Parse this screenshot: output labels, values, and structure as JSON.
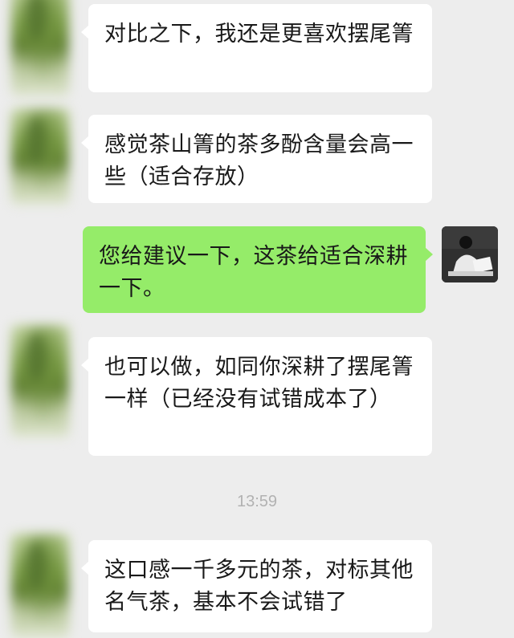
{
  "messages": [
    {
      "side": "left",
      "text": "对比之下，我还是更喜欢摆尾箐"
    },
    {
      "side": "left",
      "text": "感觉茶山箐的茶多酚含量会高一些（适合存放）"
    },
    {
      "side": "right",
      "text": "您给建议一下，这茶给适合深耕一下。"
    },
    {
      "side": "left",
      "text": "也可以做，如同你深耕了摆尾箐一样（已经没有试错成本了）"
    },
    {
      "side": "left",
      "text": "这口感一千多元的茶，对标其他名气茶，基本不会试错了"
    }
  ],
  "timestamp": "13:59",
  "colors": {
    "background": "#ededed",
    "incoming_bubble": "#ffffff",
    "outgoing_bubble": "#95ec69",
    "timestamp": "#b2b2b2"
  },
  "icons": {
    "contact_avatar": "blurred-contact-avatar-icon",
    "own_avatar": "user-photo-avatar-icon"
  }
}
